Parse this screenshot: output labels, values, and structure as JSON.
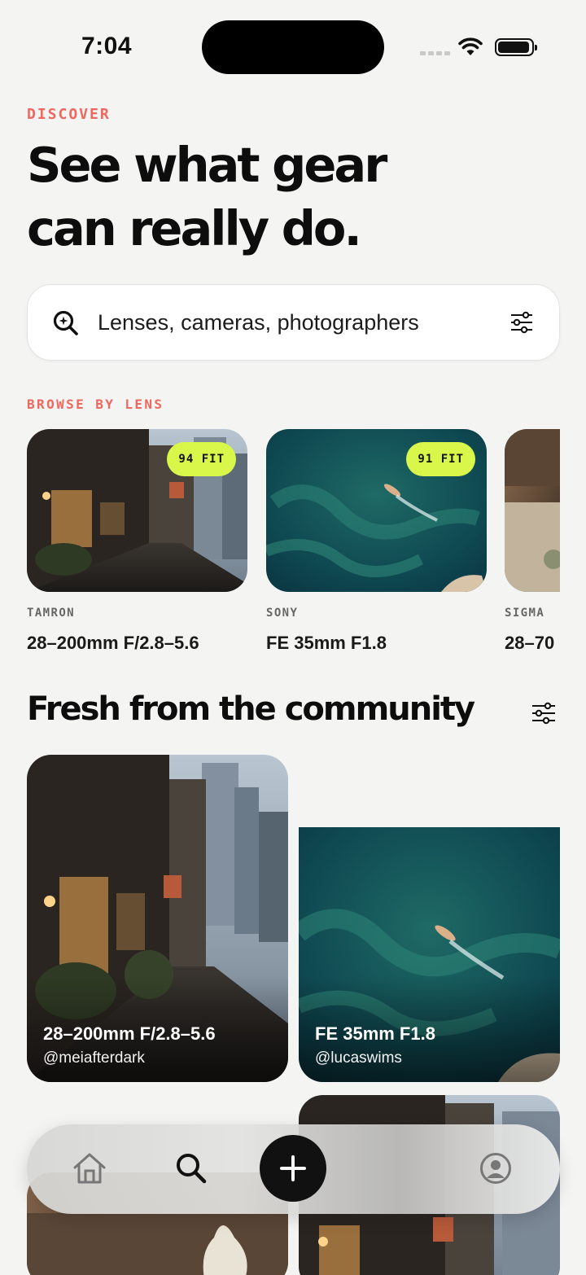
{
  "status_bar": {
    "time": "7:04"
  },
  "header": {
    "eyebrow": "DISCOVER",
    "headline_line1": "See what gear",
    "headline_line2": "can really do."
  },
  "search": {
    "placeholder": "Lenses, cameras, photographers"
  },
  "browse": {
    "label": "BROWSE BY LENS",
    "lenses": [
      {
        "brand": "TAMRON",
        "name": "28–200mm F/2.8–5.6",
        "fit": "94 FIT"
      },
      {
        "brand": "SONY",
        "name": "FE 35mm F1.8",
        "fit": "91 FIT"
      },
      {
        "brand": "SIGMA",
        "name": "28–70"
      }
    ]
  },
  "community": {
    "title": "Fresh from the community",
    "posts": [
      {
        "title": "28–200mm F/2.8–5.6",
        "user": "@meiafterdark"
      },
      {
        "title": "FE 35mm F1.8",
        "user": "@lucaswims"
      }
    ]
  },
  "tab_bar": {
    "items": [
      "home-icon",
      "search-icon",
      "plus-icon",
      "profile-icon"
    ],
    "accent": "#111111"
  },
  "colors": {
    "accent": "#f0675f",
    "fit_badge": "#d9f74a",
    "background": "#f4f4f3"
  }
}
